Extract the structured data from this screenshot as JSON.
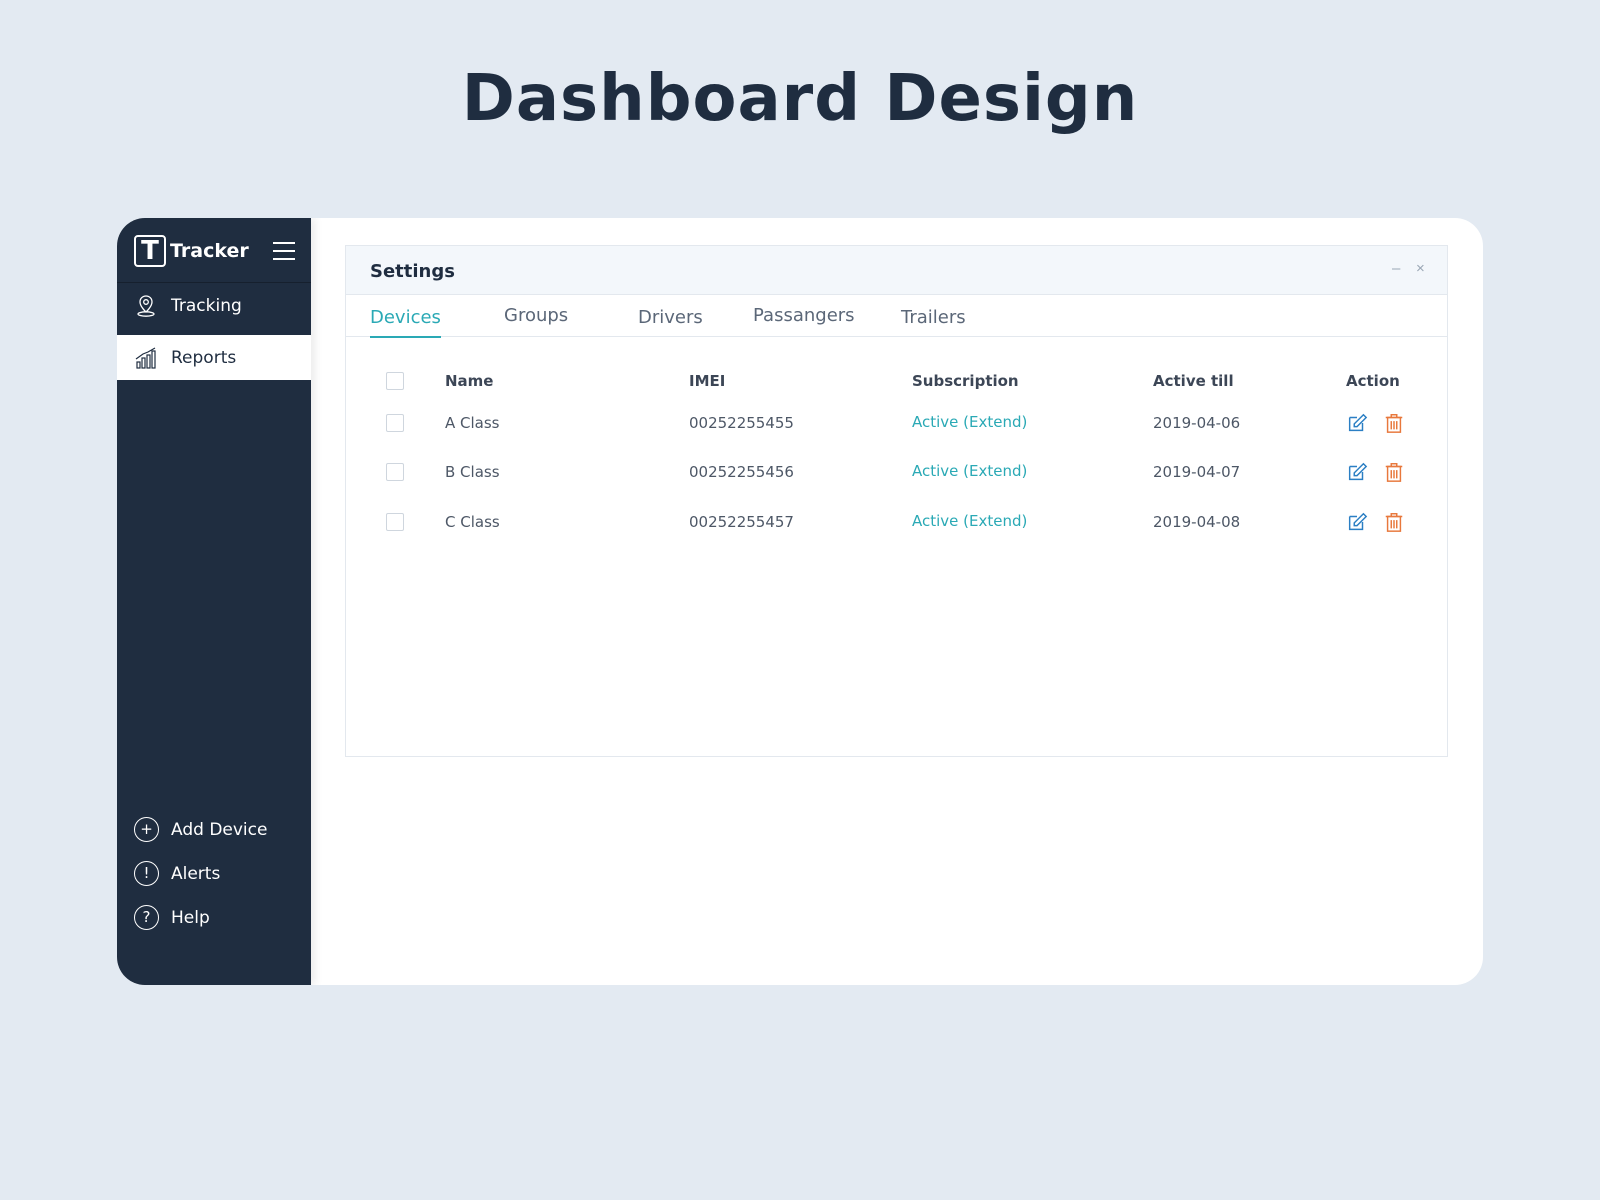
{
  "page": {
    "title": "Dashboard Design"
  },
  "sidebar": {
    "brand": {
      "logo_letter": "T",
      "name": "Tracker"
    },
    "items": [
      {
        "label": "Tracking",
        "icon": "location-pin-icon"
      },
      {
        "label": "Reports",
        "icon": "bar-chart-icon",
        "active": true
      }
    ],
    "bottom_items": [
      {
        "label": "Add Device",
        "icon": "plus-circle-icon",
        "glyph": "+"
      },
      {
        "label": "Alerts",
        "icon": "alert-circle-icon",
        "glyph": "!"
      },
      {
        "label": "Help",
        "icon": "help-circle-icon",
        "glyph": "?"
      }
    ]
  },
  "panel": {
    "title": "Settings",
    "minimize": "–",
    "close": "×",
    "tabs": [
      "Devices",
      "Groups",
      "Drivers",
      "Passangers",
      "Trailers"
    ],
    "active_tab": "Devices"
  },
  "table": {
    "columns": [
      "Name",
      "IMEI",
      "Subscription",
      "Active till",
      "Action"
    ],
    "rows": [
      {
        "name": "A Class",
        "imei": "00252255455",
        "subscription": "Active (Extend)",
        "active_till": "2019-04-06"
      },
      {
        "name": "B Class",
        "imei": "00252255456",
        "subscription": "Active (Extend)",
        "active_till": "2019-04-07"
      },
      {
        "name": "C Class",
        "imei": "00252255457",
        "subscription": "Active (Extend)",
        "active_till": "2019-04-08"
      }
    ]
  },
  "colors": {
    "sidebar": "#1f2d40",
    "accent": "#2aa9b5",
    "edit_icon": "#2b7fc4",
    "delete_icon": "#e8783c",
    "background": "#e3eaf2"
  }
}
